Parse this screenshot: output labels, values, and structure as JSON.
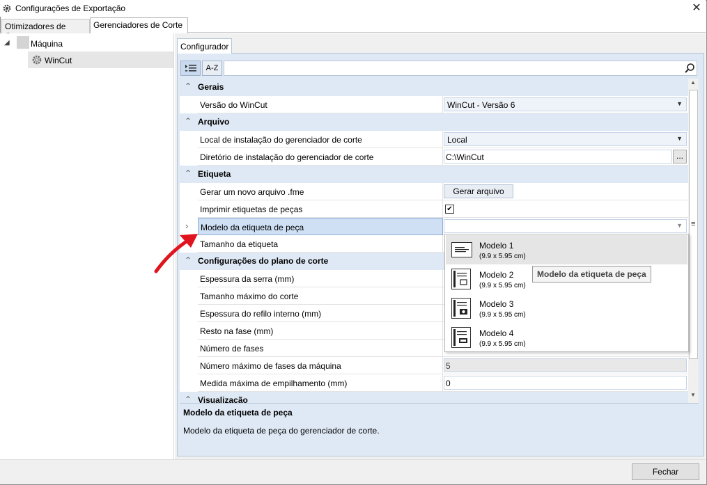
{
  "window": {
    "title": "Configurações de Exportação",
    "close_glyph": "✕"
  },
  "tabs": [
    {
      "label": "Otimizadores de Corte"
    },
    {
      "label": "Gerenciadores de Corte"
    }
  ],
  "tree": {
    "root_label": "Máquina",
    "child_label": "WinCut"
  },
  "configurator": {
    "tab_label": "Configurador",
    "sort_az_label": "A-Z"
  },
  "categories": {
    "gerais": "Gerais",
    "arquivo": "Arquivo",
    "etiqueta": "Etiqueta",
    "plano": "Configurações do plano de corte",
    "visualizacao": "Visualização"
  },
  "props": {
    "versao": {
      "name": "Versão do WinCut",
      "value": "WinCut - Versão 6"
    },
    "local": {
      "name": "Local de instalação do gerenciador de corte",
      "value": "Local"
    },
    "diretorio": {
      "name": "Diretório de instalação do gerenciador de corte",
      "value": "C:\\WinCut",
      "browse": "..."
    },
    "gerar": {
      "name": "Gerar um novo arquivo .fme",
      "button": "Gerar arquivo"
    },
    "imprimir": {
      "name": "Imprimir etiquetas de peças",
      "checked": true
    },
    "modelo": {
      "name": "Modelo da etiqueta de peça",
      "value": ""
    },
    "tamanho": {
      "name": "Tamanho da etiqueta"
    },
    "espessura_serra": {
      "name": "Espessura da serra (mm)"
    },
    "tamanho_max": {
      "name": "Tamanho máximo do corte"
    },
    "espessura_refilo": {
      "name": "Espessura do refilo interno (mm)"
    },
    "resto": {
      "name": "Resto na fase (mm)"
    },
    "num_fases": {
      "name": "Número de fases"
    },
    "num_max_fases": {
      "name": "Número máximo de fases da máquina",
      "value": "5"
    },
    "medida_max": {
      "name": "Medida máxima de empilhamento (mm)",
      "value": "0"
    }
  },
  "dropdown": {
    "items": [
      {
        "title": "Modelo 1",
        "size": "(9.9 x 5.95 cm)"
      },
      {
        "title": "Modelo 2",
        "size": "(9.9 x 5.95 cm)"
      },
      {
        "title": "Modelo 3",
        "size": "(9.9 x 5.95 cm)"
      },
      {
        "title": "Modelo 4",
        "size": "(9.9 x 5.95 cm)"
      }
    ]
  },
  "tooltip": "Modelo da etiqueta de peça",
  "description": {
    "title": "Modelo da etiqueta de peça",
    "text": "Modelo da etiqueta de peça do gerenciador de corte."
  },
  "footer": {
    "close_label": "Fechar"
  },
  "colors": {
    "accent": "#dfe9f5",
    "selected_row": "#cfe0f5",
    "annotation_arrow": "#e0141e"
  }
}
